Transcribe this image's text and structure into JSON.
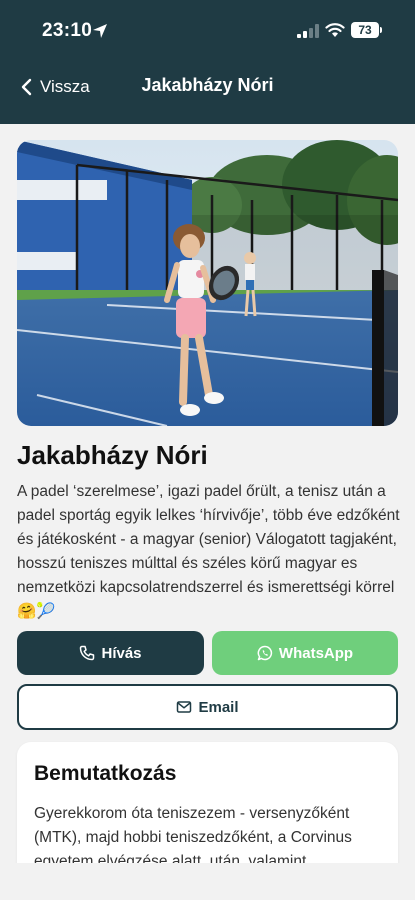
{
  "status_bar": {
    "time": "23:10",
    "battery": "73"
  },
  "nav": {
    "back_label": "Vissza",
    "title": "Jakabházy Nóri"
  },
  "profile": {
    "name": "Jakabházy Nóri",
    "bio": "A padel ‘szerelmese’, igazi padel őrült, a tenisz után a padel sportág egyik lelkes ‘hírvivője’, több éve edzőként és játékosként - a magyar (senior) Válogatott tagjaként, hosszú teniszes múlttal és széles körű magyar es nemzetközi kapcsolatrendszerrel és ismerettségi körrel 🤗🎾"
  },
  "actions": {
    "call_label": "Hívás",
    "whatsapp_label": "WhatsApp",
    "email_label": "Email"
  },
  "intro": {
    "title": "Bemutatkozás",
    "text": "Gyerekkorom óta teniszezem - versenyzőként (MTK), majd hobbi teniszedzőként, a Corvinus egyetem elvégzése alatt, után, valamint"
  },
  "colors": {
    "header": "#1f3b44",
    "accent": "#1f3b44",
    "whatsapp": "#6fcf7c",
    "background": "#f2f2f2"
  },
  "icons": {
    "back": "chevron-left-icon",
    "call": "phone-icon",
    "whatsapp": "whatsapp-icon",
    "email": "mail-icon"
  }
}
